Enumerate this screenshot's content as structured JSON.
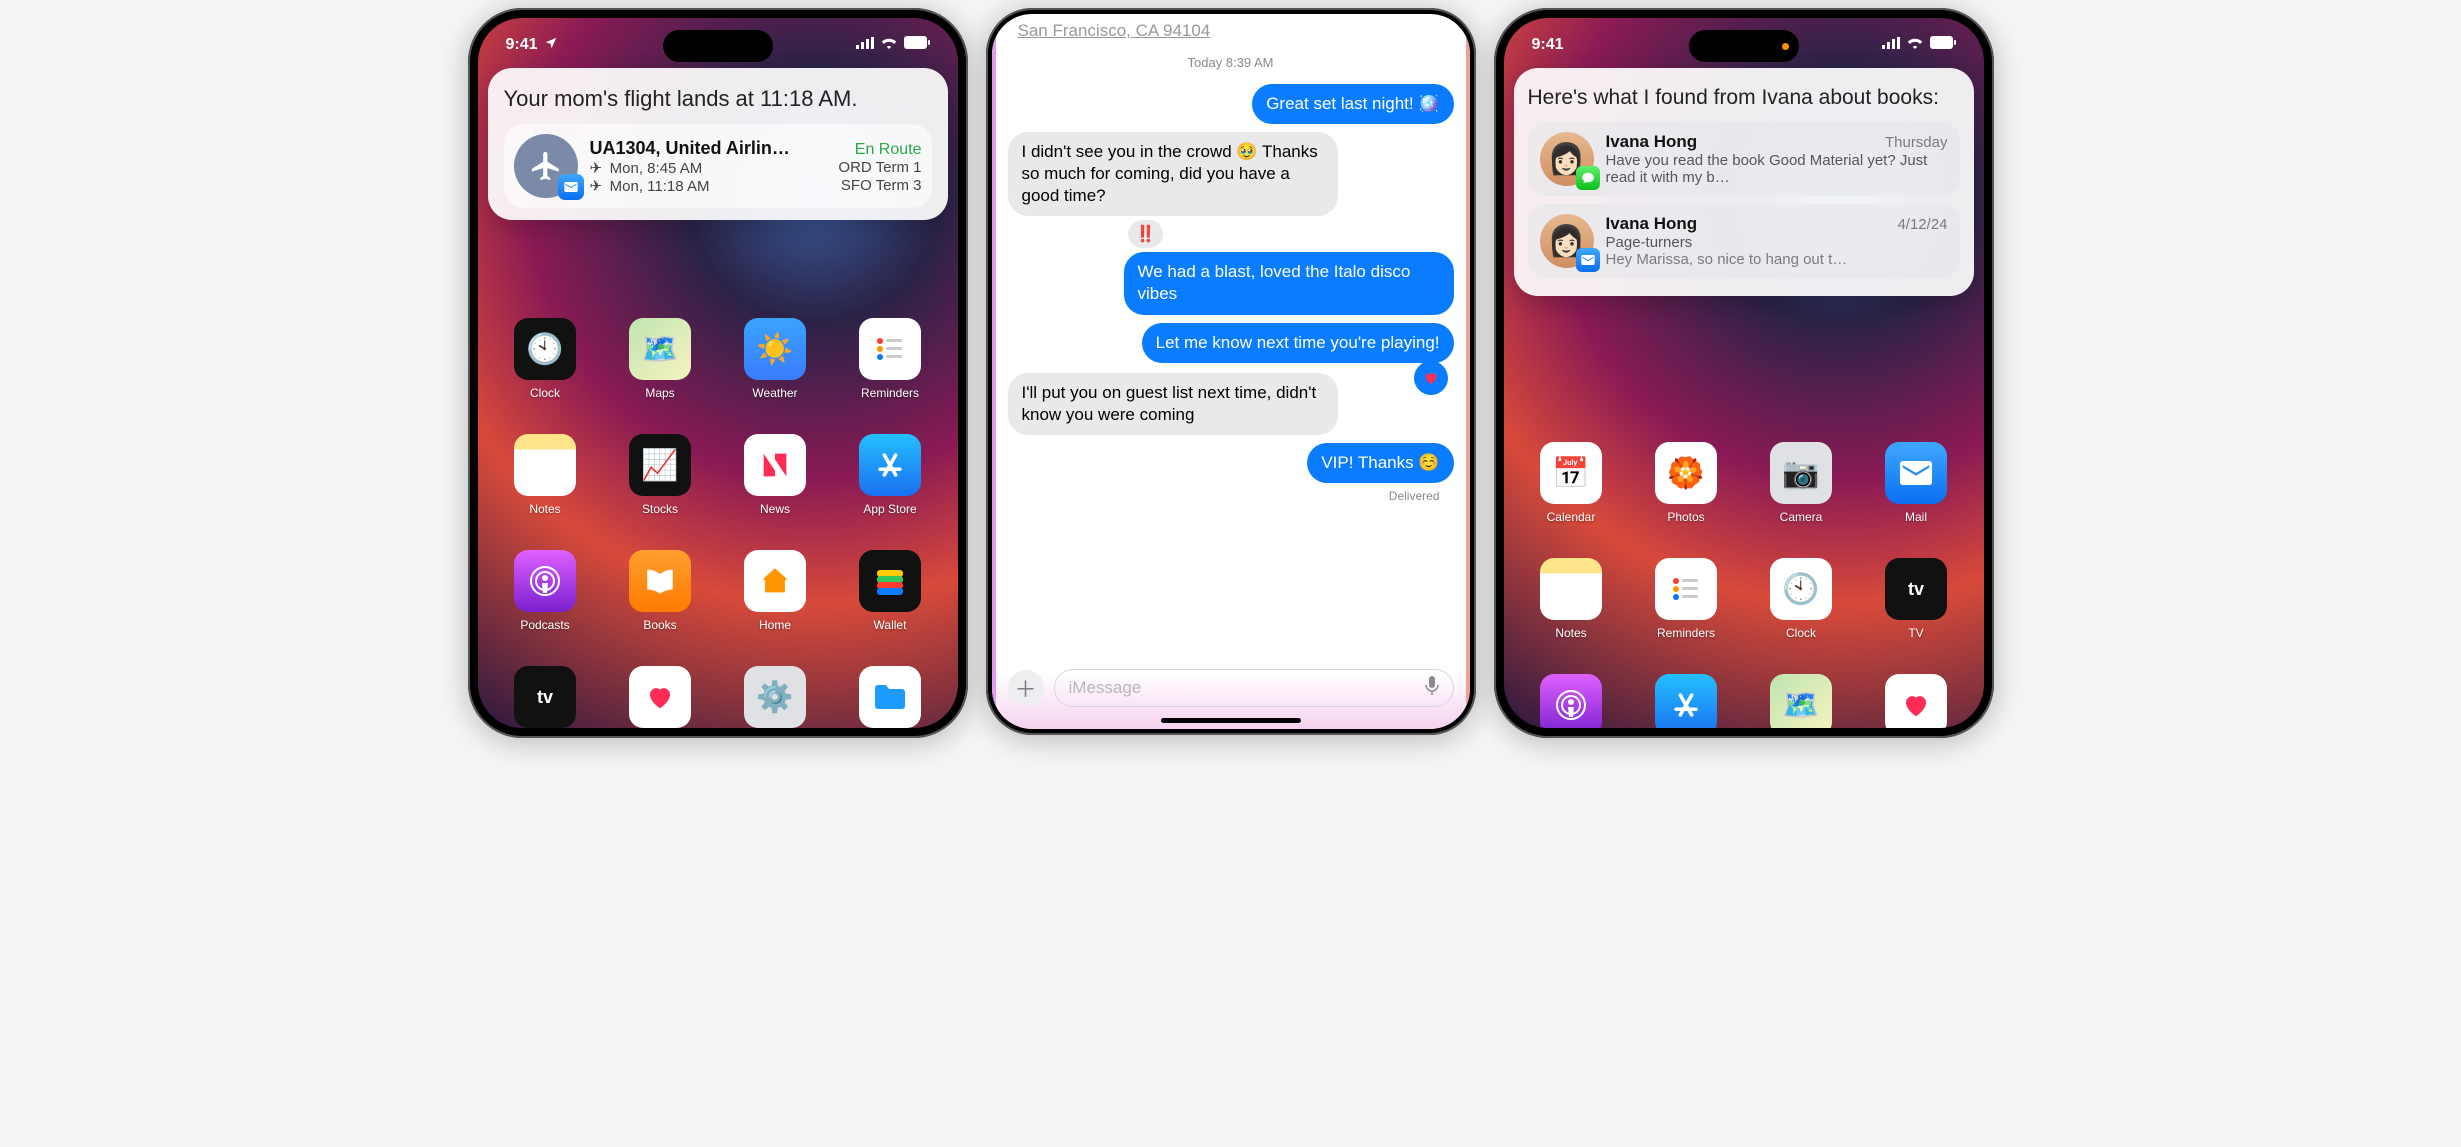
{
  "status": {
    "time": "9:41"
  },
  "phone1": {
    "card_title": "Your mom's flight lands at 11:18 AM.",
    "flight": {
      "number_airline": "UA1304, United Airlin…",
      "status": "En Route",
      "dep": "Mon, 8:45 AM",
      "dep_term": "ORD Term 1",
      "arr": "Mon, 11:18 AM",
      "arr_term": "SFO Term 3"
    },
    "apps": {
      "clock": "Clock",
      "maps": "Maps",
      "weather": "Weather",
      "reminders": "Reminders",
      "notes": "Notes",
      "stocks": "Stocks",
      "news": "News",
      "appstore": "App Store",
      "podcasts": "Podcasts",
      "books": "Books",
      "home": "Home",
      "wallet": "Wallet",
      "tv": "TV",
      "health": "Health",
      "settings": "Settings",
      "files": "Files"
    }
  },
  "phone2": {
    "addr_line2": "San Francisco, CA 94104",
    "timestamp": "Today 8:39 AM",
    "m1": "Great set last night! 🪩",
    "m2": "I didn't see you in the crowd 🥹 Thanks so much for coming, did you have a good time?",
    "tapback": "‼️",
    "m3": "We had a blast, loved the Italo disco vibes",
    "m4": "Let me know next time you're playing!",
    "m5": "I'll put you on guest list next time, didn't know you were coming",
    "m6": "VIP! Thanks ☺️",
    "delivered": "Delivered",
    "placeholder": "iMessage"
  },
  "phone3": {
    "card_title": "Here's what I found from Ivana about books:",
    "r1": {
      "name": "Ivana Hong",
      "date": "Thursday",
      "preview": "Have you read the book Good Material yet? Just read it with my b…"
    },
    "r2": {
      "name": "Ivana Hong",
      "date": "4/12/24",
      "subject": "Page-turners",
      "preview": "Hey Marissa, so nice to hang out t…"
    },
    "apps": {
      "calendar": "Calendar",
      "photos": "Photos",
      "camera": "Camera",
      "mail": "Mail",
      "notes": "Notes",
      "reminders": "Reminders",
      "clock": "Clock",
      "tv": "TV",
      "podcasts": "Podcasts",
      "appstore": "App Store",
      "maps": "Maps",
      "health": "Health"
    }
  }
}
